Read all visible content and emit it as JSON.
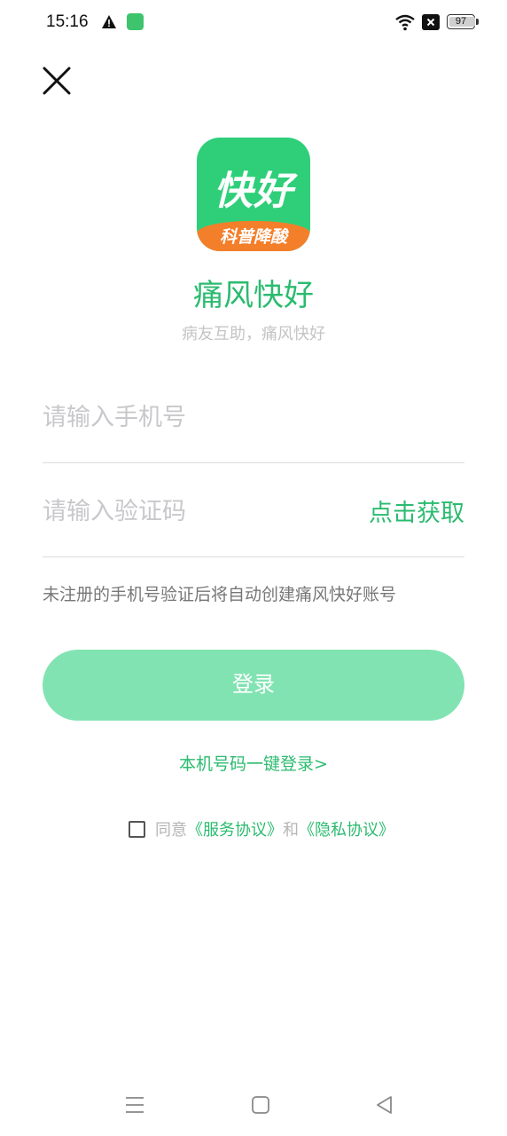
{
  "status_bar": {
    "time": "15:16",
    "battery": "97",
    "icons": [
      "warning-icon",
      "app-notification-icon",
      "wifi-icon",
      "sim-off-icon",
      "battery-icon"
    ]
  },
  "header": {
    "close_icon": "close-icon"
  },
  "logo": {
    "main_text": "快好",
    "sub_text": "科普降酸"
  },
  "app": {
    "name": "痛风快好",
    "slogan": "病友互助，痛风快好"
  },
  "form": {
    "phone_placeholder": "请输入手机号",
    "phone_value": "",
    "code_placeholder": "请输入验证码",
    "code_value": "",
    "get_code_label": "点击获取",
    "notice": "未注册的手机号验证后将自动创建痛风快好账号",
    "login_label": "登录",
    "one_key_login": "本机号码一键登录>"
  },
  "agreement": {
    "checked": false,
    "prefix": "同意",
    "service_link": "《服务协议》",
    "and": "和",
    "privacy_link": "《隐私协议》"
  },
  "colors": {
    "brand_green": "#2bbb6f",
    "button_green": "#82e3b2",
    "logo_orange": "#f47f2a"
  },
  "nav": {
    "icons": [
      "menu-icon",
      "home-icon",
      "back-icon"
    ]
  }
}
